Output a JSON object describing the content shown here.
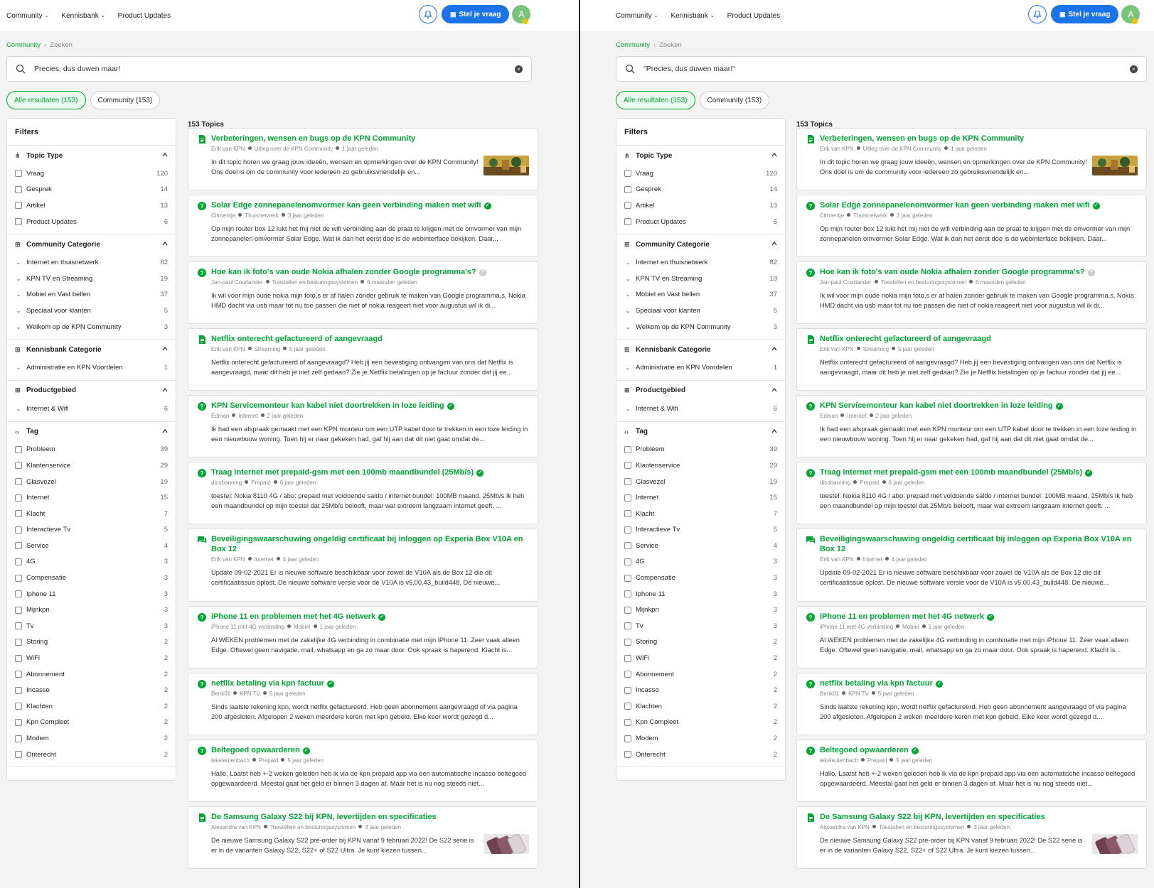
{
  "nav": {
    "items": [
      "Community",
      "Kennisbank",
      "Product Updates"
    ],
    "ask_label": "Stel je vraag",
    "avatar_initial": "A"
  },
  "breadcrumb": {
    "root": "Community",
    "current": "Zoeken"
  },
  "search": {
    "left_query": "Precies, dus duwen maar!",
    "right_query": "\"Precies, dus duwen maar!\""
  },
  "tabs": [
    "Alle resultaten (153)",
    "Community (153)"
  ],
  "filters": {
    "title": "Filters",
    "sections": [
      {
        "icon": "hierarchy-icon",
        "title": "Topic Type",
        "kind": "checkbox",
        "rows": [
          [
            "Vraag",
            "120"
          ],
          [
            "Gesprek",
            "14"
          ],
          [
            "Artikel",
            "13"
          ],
          [
            "Product Updates",
            "6"
          ]
        ]
      },
      {
        "icon": "grid-icon",
        "title": "Community Categorie",
        "kind": "chevron",
        "rows": [
          [
            "Internet en thuisnetwerk",
            "82"
          ],
          [
            "KPN TV en Streaming",
            "19"
          ],
          [
            "Mobiel en Vast bellen",
            "37"
          ],
          [
            "Speciaal voor klanten",
            "5"
          ],
          [
            "Welkom op de KPN Community",
            "3"
          ]
        ]
      },
      {
        "icon": "grid-icon",
        "title": "Kennisbank Categorie",
        "kind": "chevron",
        "rows": [
          [
            "Administratie en KPN Voordelen",
            "1"
          ]
        ]
      },
      {
        "icon": "grid-icon",
        "title": "Productgebied",
        "kind": "chevron",
        "rows": [
          [
            "Internet & Wifi",
            "6"
          ]
        ]
      },
      {
        "icon": "code-icon",
        "title": "Tag",
        "kind": "checkbox",
        "rows": [
          [
            "Probleem",
            "39"
          ],
          [
            "Klantenservice",
            "29"
          ],
          [
            "Glasvezel",
            "19"
          ],
          [
            "Internet",
            "15"
          ],
          [
            "Klacht",
            "7"
          ],
          [
            "Interactieve Tv",
            "5"
          ],
          [
            "Service",
            "4"
          ],
          [
            "4G",
            "3"
          ],
          [
            "Compensatie",
            "3"
          ],
          [
            "Iphone 11",
            "3"
          ],
          [
            "Mijnkpn",
            "3"
          ],
          [
            "Tv",
            "3"
          ],
          [
            "Storing",
            "2"
          ],
          [
            "WiFi",
            "2"
          ],
          [
            "Abonnement",
            "2"
          ],
          [
            "Incasso",
            "2"
          ],
          [
            "Klachten",
            "2"
          ],
          [
            "Kpn Compleet",
            "2"
          ],
          [
            "Modem",
            "2"
          ],
          [
            "Onterecht",
            "2"
          ]
        ]
      }
    ]
  },
  "topics_count": "153 Topics",
  "topics": [
    {
      "type": "article",
      "title": "Verbeteringen, wensen en bugs op de KPN Community",
      "solved": false,
      "question": false,
      "author": "Erik van KPN",
      "category": "Uitleg over de KPN Community",
      "time": "1 jaar geleden",
      "excerpt": "In dit topic horen we graag jouw ideeën, wensen en opmerkingen over de KPN Community! Ons doel is om de community voor iedereen zo gebruiksvriendelijk en...",
      "thumb": "photo"
    },
    {
      "type": "question",
      "title": "Solar Edge zonnepanelenomvormer kan geen verbinding maken met wifi",
      "solved": true,
      "question": false,
      "author": "Citroentje",
      "category": "Thuisnetwerk",
      "time": "3 jaar geleden",
      "excerpt": "Op mijn router box 12 lukt het mij niet de wifi verbinding aan de praat te krijgen met de omvormer van mijn zonnepanelen omvormer Solar Edge. Wat ik dan het eerst doe is de webinterface bekijken. Daar..."
    },
    {
      "type": "question",
      "title": "Hoe kan ik foto's van oude Nokia afhalen zonder Google programma's?",
      "solved": false,
      "question": true,
      "author": "Jan-paul Courlander",
      "category": "Toestellen en besturingssystemen",
      "time": "6 maanden geleden",
      "excerpt": "Ik wil voor mijn oude nokia mijn foto,s er af halen zonder gebruik te maken van Google programma,s, Nokia HMD dacht via usb maar tot nu toe passen die niet of nokia reageert niet voor augustus wil ik di..."
    },
    {
      "type": "article",
      "title": "Netflix onterecht gefactureerd of aangevraagd",
      "solved": false,
      "question": false,
      "author": "Erik van KPN",
      "category": "Streaming",
      "time": "5 jaar geleden",
      "excerpt": "Netflix onterecht gefactureerd of aangevraagd? Heb jij een bevestiging ontvangen van ons dat Netflix is aangevraagd, maar dit heb je niet zelf gedaan? Zie je Netflix betalingen op je factuur zonder dat jij ee..."
    },
    {
      "type": "question",
      "title": "KPN Servicemonteur kan kabel niet doortrekken in loze leiding",
      "solved": true,
      "question": false,
      "author": "Edman",
      "category": "Internet",
      "time": "2 jaar geleden",
      "excerpt": "Ik had een afspraak gemaakt met een KPN monteur om een UTP kabel door te trekken in een loze leiding in een nieuwbouw woning. Toen hij er naar gekeken had, gaf hij aan dat dit niet gaat omdat de..."
    },
    {
      "type": "question",
      "title": "Traag internet met prepaid-gsm met een 100mb maandbundel (25Mb/s)",
      "solved": true,
      "question": false,
      "author": "dicobanning",
      "category": "Prepaid",
      "time": "6 jaar geleden",
      "excerpt": "toestel: Nokia 8110 4G / abo: prepaid met voldoende saldo / internet bundel: 100MB maand, 25Mb/s Ik heb een maandbundel op mijn toestel dat 25Mb/s belooft, maar wat extreem langzaam internet geeft. ..."
    },
    {
      "type": "discussion",
      "title": "Beveiligingswaarschuwing ongeldig certificaat bij inloggen op Experia Box V10A en Box 12",
      "solved": false,
      "question": false,
      "tall": true,
      "author": "Erik van KPN",
      "category": "Internet",
      "time": "4 jaar geleden",
      "excerpt": "Update 09-02-2021 Er is nieuwe software beschikbaar voor zowel de V10A als de Box 12 die dit certificaatissue oplost. De nieuwe software versie voor de V10A is v5.00.43_build448. De nieuwe..."
    },
    {
      "type": "question",
      "title": "iPhone 11 en problemen met het 4G netwerk",
      "solved": true,
      "question": false,
      "author": "iPhone 11 met 4G verbinding",
      "category": "Mobiel",
      "time": "1 jaar geleden",
      "excerpt": "Al WEKEN problemen met de zakelijke 4G verbinding in combinatie met mijn iPhone 11. Zeer vaak alleen Edge. Oftewel geen navigatie, mail, whatsapp en ga zo maar door. Ook spraak is haperend. Klacht is..."
    },
    {
      "type": "question",
      "title": "netflix betaling via kpn factuur",
      "solved": true,
      "question": false,
      "author": "Benk01",
      "category": "KPN TV",
      "time": "5 jaar geleden",
      "excerpt": "Sinds laatste rekening kpn, wordt netflix gefactureerd. Heb geen abonnement aangevraagd of via pagina 200 afgesloten. Afgelopen 2 weken meerdere keren met kpn gebeld. Elke keer wordt gezegd d..."
    },
    {
      "type": "question",
      "title": "Beltegoed opwaarderen",
      "solved": true,
      "question": false,
      "author": "iekelautenbach",
      "category": "Prepaid",
      "time": "5 jaar geleden",
      "excerpt": "Hallo, Laatst heb +-2 weken geleden heb ik via de kpn prepaid app via een automatische incasso beltegoed opgewaardeerd. Meestal gaat het geld er binnen 3 dagen af. Maar het is nu nog steeds niet..."
    },
    {
      "type": "article",
      "title": "De Samsung Galaxy S22 bij KPN, levertijden en specificaties",
      "solved": false,
      "question": false,
      "author": "Alexandra van KPN",
      "category": "Toestellen en besturingssystemen",
      "time": "3 jaar geleden",
      "excerpt": "De nieuwe Samsung Galaxy S22 pre-order bij KPN vanaf 9 februari 2022! De S22 serie is er in de varianten Galaxy S22, S22+ of S22 Ultra. Je kunt kiezen tussen...",
      "thumb": "phone"
    }
  ],
  "colors": {
    "accent": "#00a832",
    "primary": "#1a73e8"
  }
}
